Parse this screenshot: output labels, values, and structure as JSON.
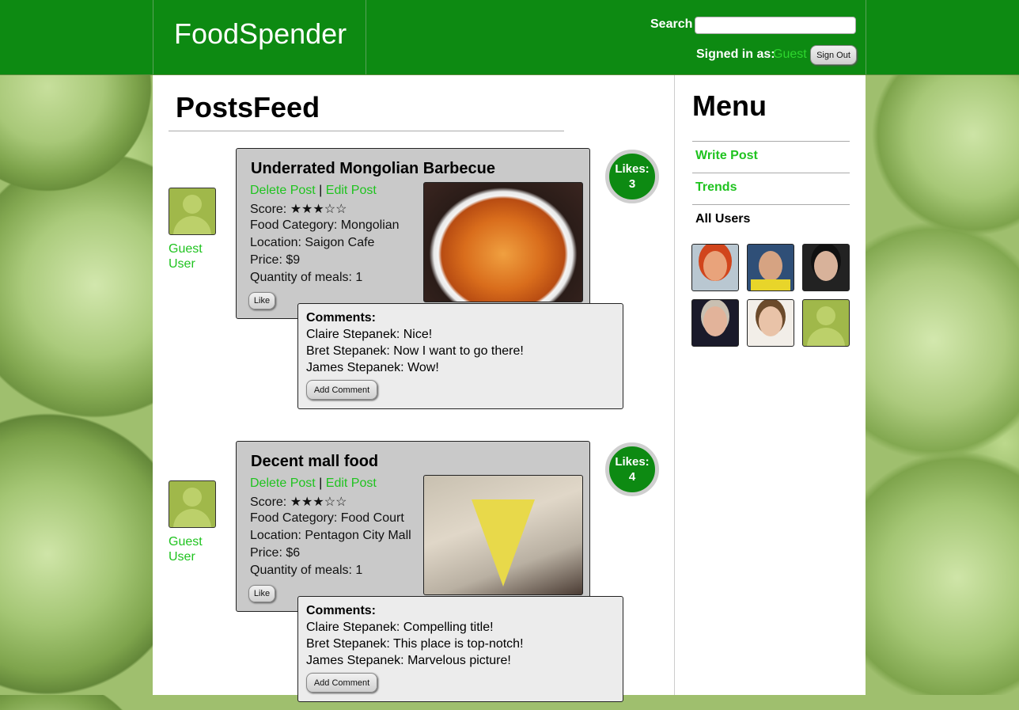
{
  "header": {
    "brand": "FoodSpender",
    "search_label": "Search",
    "search_value": "",
    "signed_in_label": "Signed in as:",
    "signed_in_user": "Guest",
    "sign_out": "Sign Out"
  },
  "feed": {
    "title": "PostsFeed",
    "posts": [
      {
        "author": "Guest User",
        "title": "Underrated Mongolian Barbecue",
        "delete": "Delete Post",
        "separator": "|",
        "edit": "Edit Post",
        "score_label": "Score:",
        "stars": "★★★☆☆",
        "category": "Food Category: Mongolian",
        "location": "Location: Saigon Cafe",
        "price": "Price: $9",
        "quantity": "Quantity of meals: 1",
        "like_button": "Like",
        "likes_label": "Likes:",
        "likes_count": "3",
        "comments_title": "Comments:",
        "comments": [
          "Claire Stepanek: Nice!",
          "Bret Stepanek: Now I want to go there!",
          "James Stepanek: Wow!"
        ],
        "add_comment": "Add Comment"
      },
      {
        "author": "Guest User",
        "title": "Decent mall food",
        "delete": "Delete Post",
        "separator": "|",
        "edit": "Edit Post",
        "score_label": "Score:",
        "stars": "★★★☆☆",
        "category": "Food Category: Food Court",
        "location": "Location: Pentagon City Mall",
        "price": "Price: $6",
        "quantity": "Quantity of meals: 1",
        "like_button": "Like",
        "likes_label": "Likes:",
        "likes_count": "4",
        "comments_title": "Comments:",
        "comments": [
          "Claire Stepanek: Compelling title!",
          "Bret Stepanek: This place is top-notch!",
          "James Stepanek: Marvelous picture!"
        ],
        "add_comment": "Add Comment"
      }
    ]
  },
  "menu": {
    "title": "Menu",
    "items": [
      "Write Post",
      "Trends",
      "All Users"
    ]
  },
  "colors": {
    "brand_green": "#0d8a12",
    "link_green": "#1fc31f"
  }
}
